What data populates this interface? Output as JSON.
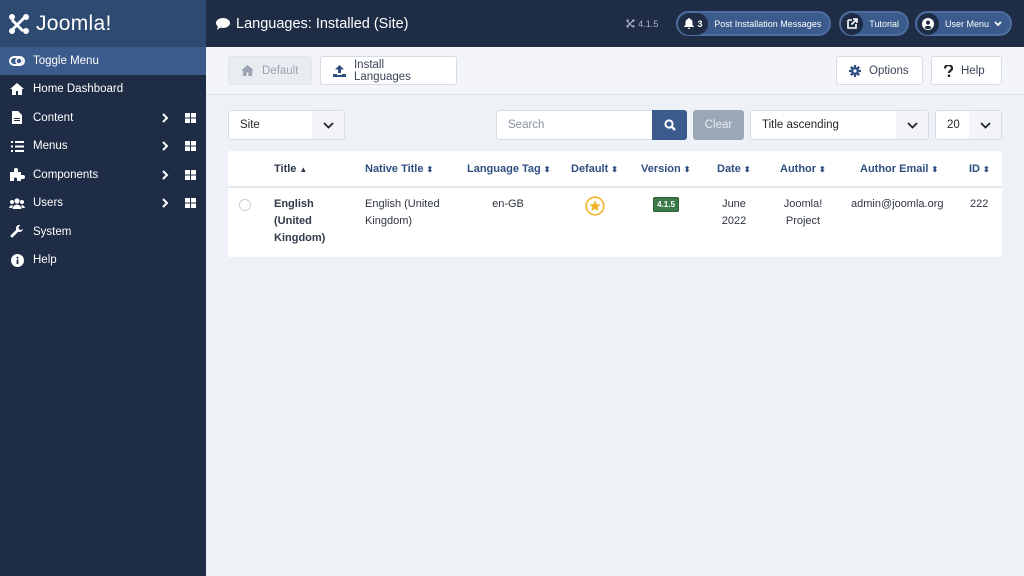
{
  "app": {
    "name": "Joomla!",
    "version": "4.1.5"
  },
  "header": {
    "title": "Languages: Installed (Site)",
    "title_icon": "comment-icon",
    "version_label": "4.1.5",
    "notifications": {
      "count": "3",
      "label": "Post Installation Messages"
    },
    "tutorial_label": "Tutorial",
    "user_menu_label": "User Menu"
  },
  "sidebar": {
    "toggle_label": "Toggle Menu",
    "items": [
      {
        "label": "Home Dashboard",
        "icon": "home-icon",
        "expandable": false
      },
      {
        "label": "Content",
        "icon": "file-icon",
        "expandable": true
      },
      {
        "label": "Menus",
        "icon": "list-icon",
        "expandable": true
      },
      {
        "label": "Components",
        "icon": "puzzle-icon",
        "expandable": true
      },
      {
        "label": "Users",
        "icon": "users-icon",
        "expandable": true
      },
      {
        "label": "System",
        "icon": "wrench-icon",
        "expandable": false
      },
      {
        "label": "Help",
        "icon": "info-icon",
        "expandable": false
      }
    ]
  },
  "toolbar": {
    "default_label": "Default",
    "install_label": "Install Languages",
    "options_label": "Options",
    "help_label": "Help"
  },
  "filters": {
    "client_value": "Site",
    "search_placeholder": "Search",
    "clear_label": "Clear",
    "ordering_value": "Title ascending",
    "limit_value": "20"
  },
  "table": {
    "columns": [
      {
        "label": "Title",
        "sort": "▲"
      },
      {
        "label": "Native Title",
        "sort": "⬍"
      },
      {
        "label": "Language Tag",
        "sort": "⬍"
      },
      {
        "label": "Default",
        "sort": "⬍"
      },
      {
        "label": "Version",
        "sort": "⬍"
      },
      {
        "label": "Date",
        "sort": "⬍"
      },
      {
        "label": "Author",
        "sort": "⬍"
      },
      {
        "label": "Author Email",
        "sort": "⬍"
      },
      {
        "label": "ID",
        "sort": "⬍"
      }
    ],
    "rows": [
      {
        "title": "English (United Kingdom)",
        "native_title": "English (United Kingdom)",
        "language_tag": "en-GB",
        "default": true,
        "version": "4.1.5",
        "date": "June 2022",
        "author": "Joomla! Project",
        "author_email": "admin@joomla.org",
        "id": "222"
      }
    ]
  },
  "colors": {
    "sidebar_bg": "#1f2c45",
    "accent": "#3a5b8c",
    "star": "#f0b429",
    "version_badge": "#3d7a4a"
  }
}
